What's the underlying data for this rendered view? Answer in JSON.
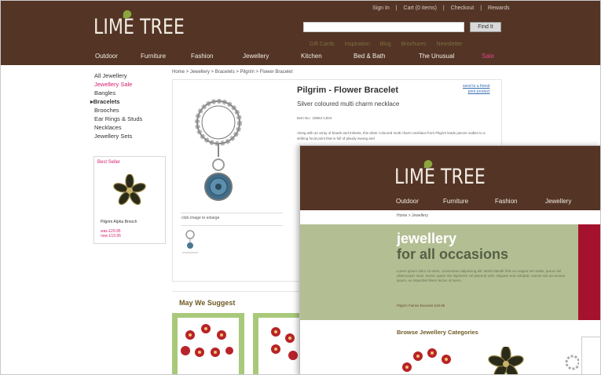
{
  "brand": {
    "logo_text": "LIME TREE",
    "primary_color": "#533425",
    "accent_sale": "#d6206d",
    "leaf_color": "#8aa63c"
  },
  "top_links": [
    "Sign In",
    "|",
    "Cart (0 items)",
    "|",
    "Checkout",
    "|",
    "Rewards"
  ],
  "search": {
    "value": "",
    "button_label": "Find It"
  },
  "sub_links": [
    "Gift Cards",
    "Inspiration",
    "Blog",
    "Brochures",
    "Newsletter"
  ],
  "main_nav": [
    "Outdoor",
    "Furniture",
    "Fashion",
    "Jewellery",
    "Kitchen",
    "Bed & Bath",
    "The Unusual",
    "Sale"
  ],
  "sidebar": {
    "items": [
      {
        "label": "All Jewellery"
      },
      {
        "label": "Jewellery Sale"
      },
      {
        "label": "Bangles"
      },
      {
        "label": "Bracelets"
      },
      {
        "label": "Brooches"
      },
      {
        "label": "Ear Rings & Studs"
      },
      {
        "label": "Necklaces"
      },
      {
        "label": "Jewellery Sets"
      }
    ],
    "best_seller": {
      "title": "Best Seller",
      "name": "Pilgrim Alpha Brooch",
      "price_was": "was £29.95",
      "price_now": "now £19.95"
    }
  },
  "breadcrumb": "Home  >  Jewellery  >  Bracelets  >  Pilgrim  >  Flower Bracelet",
  "product": {
    "title": "Pilgrim - Flower Bracelet",
    "subtitle": "Silver coloured multi charm necklace",
    "item_no": "Item No.: 19563 CZ04",
    "description": "Along with an array of beads and trinkets, this silver coloured multi charm necklace from Pilgrim leads pieces oodles to a striking focal point that is full of plaudy swung and",
    "side_links": [
      "send to a friend",
      "print product"
    ],
    "click_hint": "click image to enlarge"
  },
  "suggest": {
    "heading": "May We Suggest"
  },
  "overlay": {
    "logo_text": "LIME TREE",
    "nav": [
      "Outdoor",
      "Furniture",
      "Fashion",
      "Jewellery"
    ],
    "breadcrumb": "Home  >  Jewellery",
    "hero": {
      "line1": "jewellery",
      "line2": "for all occasions",
      "body": "Lorem ipsum dolor sit amet, consectetur adipiscing elit. Morbi blandit felis eu magna vel mattis, purus nisl ullamcorper risus. Donec quam nisi dignissim vel placerat velit. Aliquam erat volutpat, mauris nisi accumsan ipsum, eu imperdiet libero lectus id lorem.",
      "promo": "Pilgrim Fairies Bracelet £49.95",
      "accent_color": "#a5122d"
    },
    "browse_heading": "Browse Jewellery Categories"
  }
}
